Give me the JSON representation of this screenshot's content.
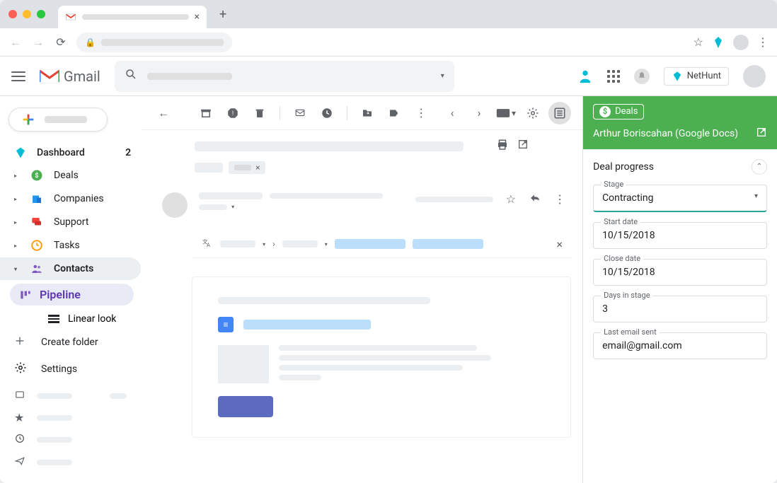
{
  "gmail": {
    "brand": "Gmail"
  },
  "nethunt_ext": {
    "label": "NetHunt"
  },
  "sidebar": {
    "dashboard": {
      "label": "Dashboard",
      "count": "2"
    },
    "items": [
      {
        "label": "Deals"
      },
      {
        "label": "Companies"
      },
      {
        "label": "Support"
      },
      {
        "label": "Tasks"
      },
      {
        "label": "Contacts"
      }
    ],
    "sub": {
      "pipeline": "Pipeline",
      "linear": "Linear look"
    },
    "create_folder": "Create folder",
    "settings": "Settings"
  },
  "panel": {
    "tag": "Deals",
    "contact": "Arthur Boriscahan (Google Docs)",
    "section": "Deal progress",
    "stage": {
      "label": "Stage",
      "value": "Contracting"
    },
    "start_date": {
      "label": "Start date",
      "value": "10/15/2018"
    },
    "close_date": {
      "label": "Close date",
      "value": "10/15/2018"
    },
    "days_in_stage": {
      "label": "Days in stage",
      "value": "3"
    },
    "last_email": {
      "label": "Last email sent",
      "value": "email@gmail.com"
    }
  }
}
